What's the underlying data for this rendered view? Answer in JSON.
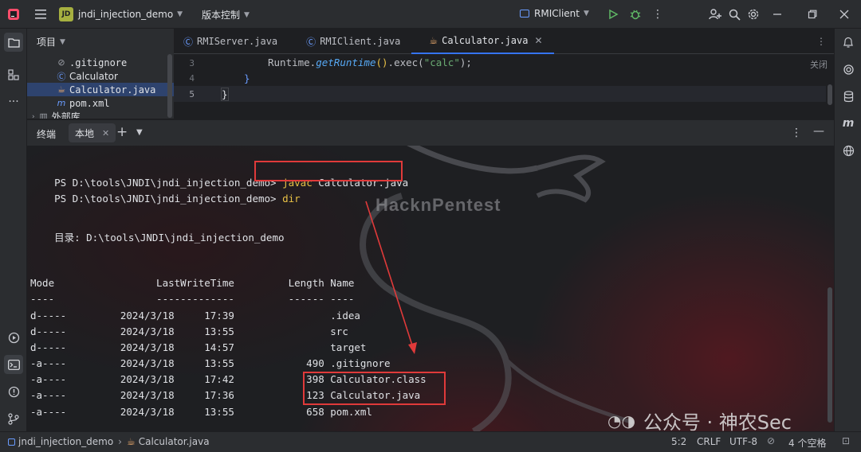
{
  "titlebar": {
    "project_name": "jndi_injection_demo",
    "project_initials": "JD",
    "vcs_label": "版本控制",
    "run_config": "RMIClient"
  },
  "project_panel": {
    "title": "项目",
    "items": [
      {
        "icon": "ignore-file-icon",
        "label": ".gitignore"
      },
      {
        "icon": "class-icon",
        "label": "Calculator"
      },
      {
        "icon": "java-file-icon",
        "label": "Calculator.java",
        "selected": true
      },
      {
        "icon": "maven-icon",
        "label": "pom.xml"
      },
      {
        "icon": "library-icon",
        "label": "外部库"
      }
    ]
  },
  "editor": {
    "tabs": [
      {
        "label": "RMIServer.java",
        "active": false
      },
      {
        "label": "RMIClient.java",
        "active": false
      },
      {
        "label": "Calculator.java",
        "active": true
      }
    ],
    "close_hint": "关闭",
    "lines": [
      {
        "num": "3",
        "text": "Runtime.getRuntime().exec(\"calc\");"
      },
      {
        "num": "4",
        "text": "}"
      },
      {
        "num": "5",
        "text": "}"
      }
    ]
  },
  "terminal": {
    "header_label": "终端",
    "tab_label": "本地",
    "prompt": "PS D:\\tools\\JNDI\\jndi_injection_demo>",
    "cmd1_keyword": "javac",
    "cmd1_arg": "Calculator.java",
    "cmd2": "dir",
    "dir_line": "    目录: D:\\tools\\JNDI\\jndi_injection_demo",
    "header_row": "Mode                 LastWriteTime         Length Name",
    "sep_row": "----                 -------------         ------ ----",
    "rows": [
      "d-----         2024/3/18     17:39                .idea",
      "d-----         2024/3/18     13:55                src",
      "d-----         2024/3/18     14:57                target",
      "-a----         2024/3/18     13:55            490 .gitignore",
      "-a----         2024/3/18     17:42            398 Calculator.class",
      "-a----         2024/3/18     17:36            123 Calculator.java",
      "-a----         2024/3/18     13:55            658 pom.xml"
    ]
  },
  "watermarks": {
    "center": "HacknPentest",
    "bottom": "公众号 · 神农Sec"
  },
  "statusbar": {
    "project": "jndi_injection_demo",
    "file": "Calculator.java",
    "position": "5:2",
    "line_sep": "CRLF",
    "encoding": "UTF-8",
    "indent": "4 个空格"
  },
  "colors": {
    "accent": "#3574f0",
    "highlight_box": "#e03a3a",
    "keyword": "#e8c146"
  }
}
